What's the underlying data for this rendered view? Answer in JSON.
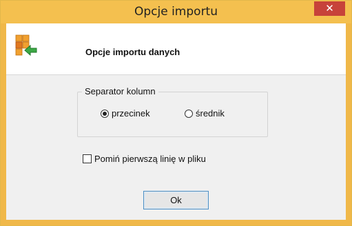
{
  "window": {
    "title": "Opcje importu",
    "close_glyph": "✕"
  },
  "header": {
    "title": "Opcje importu danych",
    "icon": "import-table-icon"
  },
  "separator": {
    "legend": "Separator kolumn",
    "options": [
      {
        "label": "przecinek",
        "checked": true
      },
      {
        "label": "średnik",
        "checked": false
      }
    ]
  },
  "skip_first_line": {
    "label": "Pomiń pierwszą linię w pliku",
    "checked": false
  },
  "ok_button": {
    "label": "Ok"
  },
  "colors": {
    "titlebar": "#f4c04f",
    "close": "#c7423a",
    "dialog_bg": "#f0f0f0",
    "button_border": "#4a90c8"
  }
}
